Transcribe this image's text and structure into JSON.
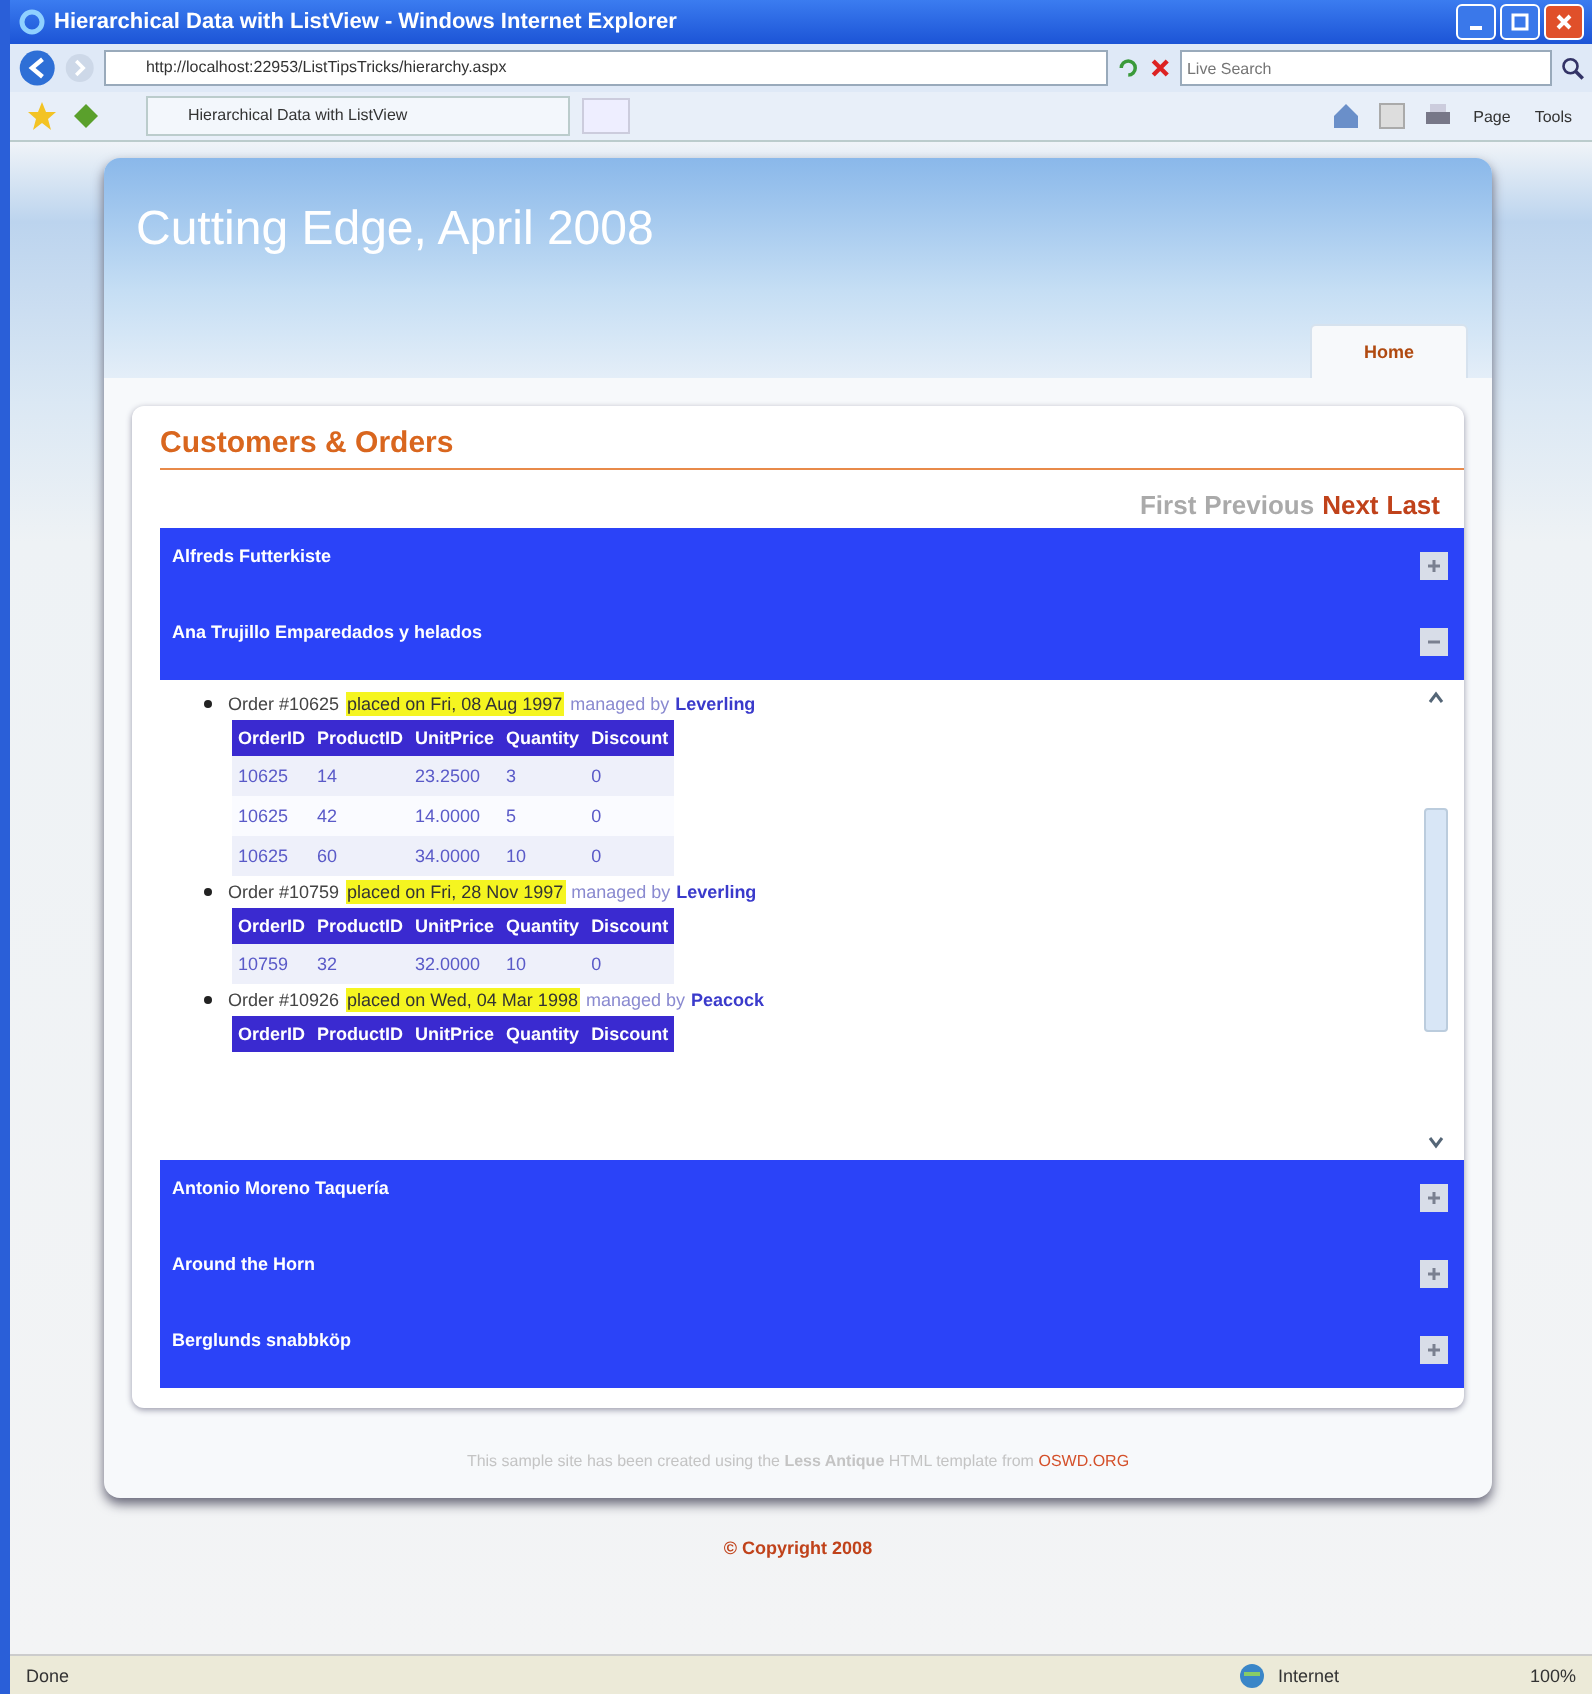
{
  "window": {
    "title": "Hierarchical Data with ListView - Windows Internet Explorer"
  },
  "address_bar": {
    "url": "http://localhost:22953/ListTipsTricks/hierarchy.aspx",
    "search_placeholder": "Live Search"
  },
  "tab": {
    "label": "Hierarchical Data with ListView"
  },
  "command_bar": [
    {
      "label": "Page"
    },
    {
      "label": "Tools"
    }
  ],
  "site": {
    "title": "Cutting Edge, April 2008",
    "nav": [
      {
        "label": "Home",
        "selected": true
      }
    ],
    "heading": "Customers & Orders",
    "pager": [
      {
        "label": "First",
        "disabled": true
      },
      {
        "label": "Previous",
        "disabled": true
      },
      {
        "label": "Next",
        "disabled": false
      },
      {
        "label": "Last",
        "disabled": false
      }
    ],
    "customers": [
      {
        "name": "Alfreds Futterkiste",
        "expanded": false
      },
      {
        "name": "Ana Trujillo Emparedados y helados",
        "expanded": true,
        "orders": [
          {
            "number": "Order #10625",
            "placed": "placed on Fri, 08 Aug 1997",
            "managed_label": "managed by",
            "employee": "Leverling",
            "columns": [
              "OrderID",
              "ProductID",
              "UnitPrice",
              "Quantity",
              "Discount"
            ],
            "rows": [
              [
                "10625",
                "14",
                "23.2500",
                "3",
                "0"
              ],
              [
                "10625",
                "42",
                "14.0000",
                "5",
                "0"
              ],
              [
                "10625",
                "60",
                "34.0000",
                "10",
                "0"
              ]
            ]
          },
          {
            "number": "Order #10759",
            "placed": "placed on Fri, 28 Nov 1997",
            "managed_label": "managed by",
            "employee": "Leverling",
            "columns": [
              "OrderID",
              "ProductID",
              "UnitPrice",
              "Quantity",
              "Discount"
            ],
            "rows": [
              [
                "10759",
                "32",
                "32.0000",
                "10",
                "0"
              ]
            ]
          },
          {
            "number": "Order #10926",
            "placed": "placed on Wed, 04 Mar 1998",
            "managed_label": "managed by",
            "employee": "Peacock",
            "columns": [
              "OrderID",
              "ProductID",
              "UnitPrice",
              "Quantity",
              "Discount"
            ]
          }
        ]
      },
      {
        "name": "Antonio Moreno Taquería",
        "expanded": false
      },
      {
        "name": "Around the Horn",
        "expanded": false
      },
      {
        "name": "Berglunds snabbköp",
        "expanded": false
      }
    ],
    "credit": "This sample site has been created using the **Less Antique** HTML template from",
    "credit_link": "OSWD.ORG",
    "copyright": "© Copyright 2008"
  },
  "status_bar": {
    "text": "Done",
    "zone": "Internet",
    "zoom": "100%"
  }
}
